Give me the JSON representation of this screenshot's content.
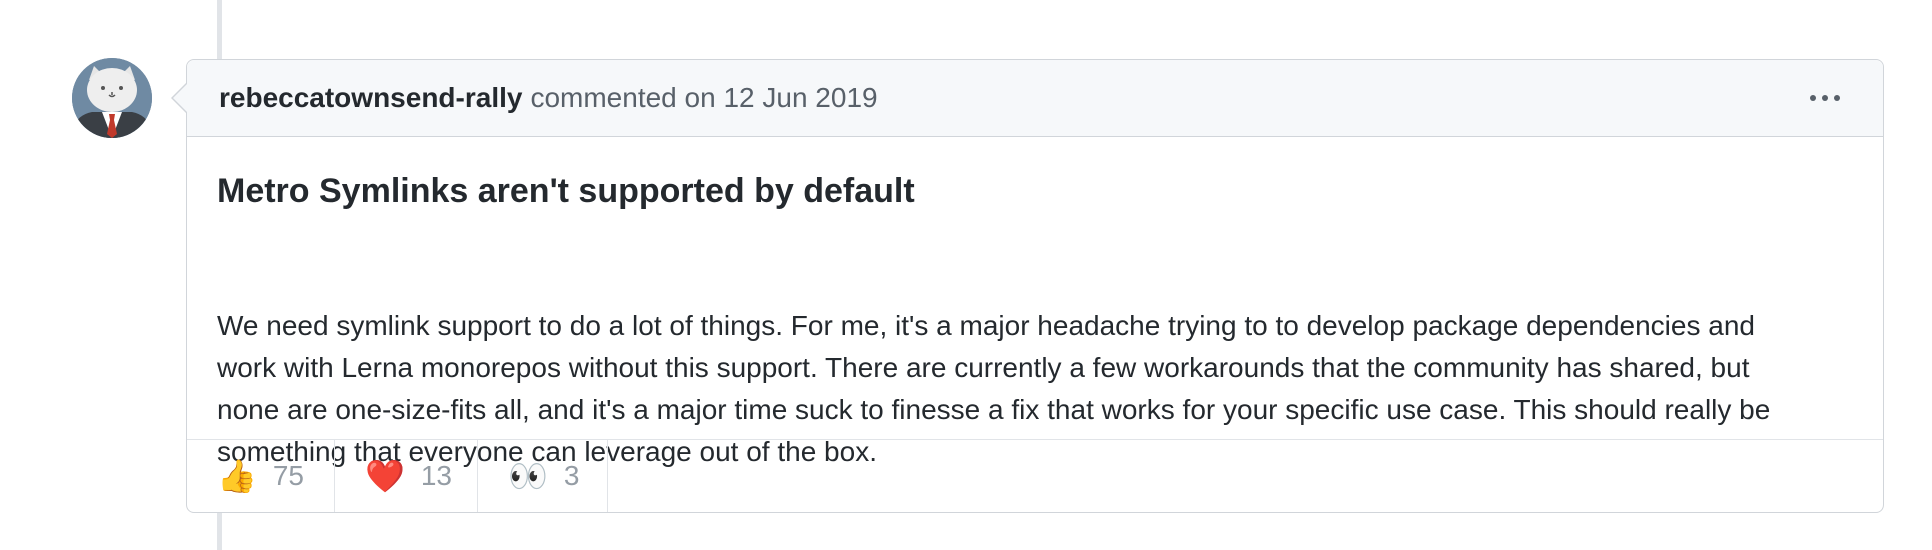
{
  "comment": {
    "author": "rebeccatownsend-rally",
    "meta": "commented on 12 Jun 2019",
    "title": "Metro Symlinks aren't supported by default",
    "body_lines": [
      "We need symlink support to do a lot of things. For me, it's a major headache trying to to develop package dependencies and",
      "work with Lerna monorepos without this support. There are currently a few workarounds that the community has shared, but",
      "none are one-size-fits all, and it's a major time suck to finesse a fix that works for your specific use case. This should really be",
      "something that everyone can leverage out of the box."
    ]
  },
  "reactions": [
    {
      "emoji": "👍",
      "icon": "thumbs-up-icon",
      "count": "75"
    },
    {
      "emoji": "❤️",
      "icon": "heart-icon",
      "count": "13"
    },
    {
      "emoji": "👀",
      "icon": "eyes-icon",
      "count": "3"
    }
  ]
}
